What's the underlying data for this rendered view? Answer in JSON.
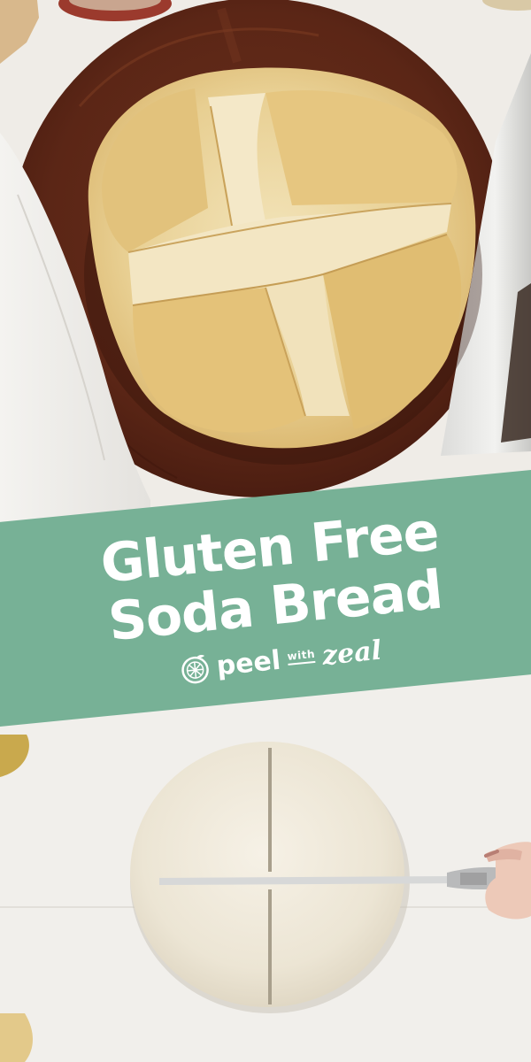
{
  "banner": {
    "title_line_1": "Gluten Free",
    "title_line_2": "Soda Bread",
    "color": "#77b196"
  },
  "brand": {
    "word_1": "peel",
    "word_2": "with",
    "word_3": "zeal",
    "logo_icon": "citrus-slice-icon"
  },
  "photos": {
    "top": "baked soda bread loaf on wooden board",
    "bottom": "raw dough being scored with a knife"
  }
}
